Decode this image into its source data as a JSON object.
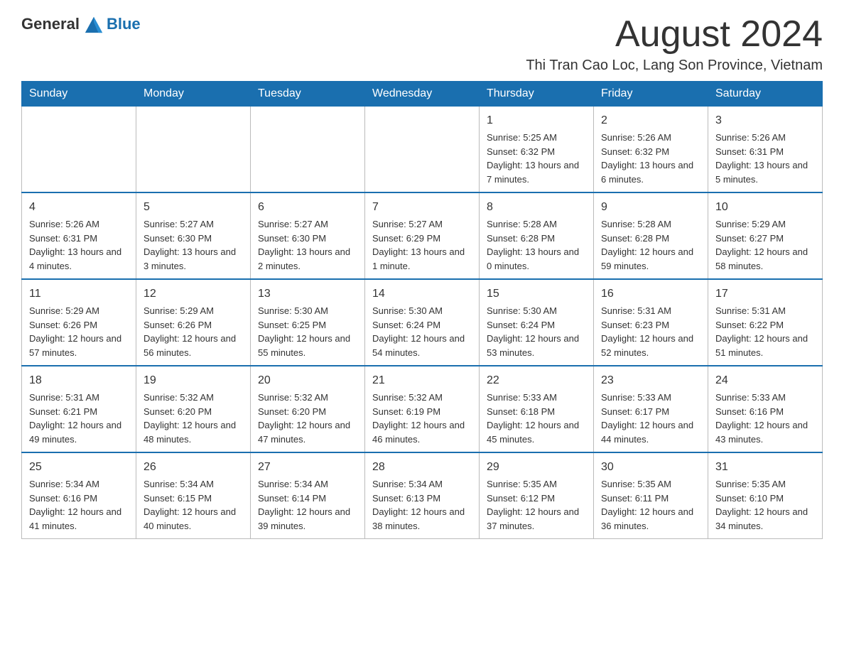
{
  "header": {
    "logo": {
      "text_general": "General",
      "text_blue": "Blue",
      "icon_alt": "GeneralBlue logo"
    },
    "title": "August 2024",
    "subtitle": "Thi Tran Cao Loc, Lang Son Province, Vietnam"
  },
  "calendar": {
    "days_of_week": [
      "Sunday",
      "Monday",
      "Tuesday",
      "Wednesday",
      "Thursday",
      "Friday",
      "Saturday"
    ],
    "weeks": [
      {
        "days": [
          {
            "num": "",
            "info": ""
          },
          {
            "num": "",
            "info": ""
          },
          {
            "num": "",
            "info": ""
          },
          {
            "num": "",
            "info": ""
          },
          {
            "num": "1",
            "info": "Sunrise: 5:25 AM\nSunset: 6:32 PM\nDaylight: 13 hours and 7 minutes."
          },
          {
            "num": "2",
            "info": "Sunrise: 5:26 AM\nSunset: 6:32 PM\nDaylight: 13 hours and 6 minutes."
          },
          {
            "num": "3",
            "info": "Sunrise: 5:26 AM\nSunset: 6:31 PM\nDaylight: 13 hours and 5 minutes."
          }
        ]
      },
      {
        "days": [
          {
            "num": "4",
            "info": "Sunrise: 5:26 AM\nSunset: 6:31 PM\nDaylight: 13 hours and 4 minutes."
          },
          {
            "num": "5",
            "info": "Sunrise: 5:27 AM\nSunset: 6:30 PM\nDaylight: 13 hours and 3 minutes."
          },
          {
            "num": "6",
            "info": "Sunrise: 5:27 AM\nSunset: 6:30 PM\nDaylight: 13 hours and 2 minutes."
          },
          {
            "num": "7",
            "info": "Sunrise: 5:27 AM\nSunset: 6:29 PM\nDaylight: 13 hours and 1 minute."
          },
          {
            "num": "8",
            "info": "Sunrise: 5:28 AM\nSunset: 6:28 PM\nDaylight: 13 hours and 0 minutes."
          },
          {
            "num": "9",
            "info": "Sunrise: 5:28 AM\nSunset: 6:28 PM\nDaylight: 12 hours and 59 minutes."
          },
          {
            "num": "10",
            "info": "Sunrise: 5:29 AM\nSunset: 6:27 PM\nDaylight: 12 hours and 58 minutes."
          }
        ]
      },
      {
        "days": [
          {
            "num": "11",
            "info": "Sunrise: 5:29 AM\nSunset: 6:26 PM\nDaylight: 12 hours and 57 minutes."
          },
          {
            "num": "12",
            "info": "Sunrise: 5:29 AM\nSunset: 6:26 PM\nDaylight: 12 hours and 56 minutes."
          },
          {
            "num": "13",
            "info": "Sunrise: 5:30 AM\nSunset: 6:25 PM\nDaylight: 12 hours and 55 minutes."
          },
          {
            "num": "14",
            "info": "Sunrise: 5:30 AM\nSunset: 6:24 PM\nDaylight: 12 hours and 54 minutes."
          },
          {
            "num": "15",
            "info": "Sunrise: 5:30 AM\nSunset: 6:24 PM\nDaylight: 12 hours and 53 minutes."
          },
          {
            "num": "16",
            "info": "Sunrise: 5:31 AM\nSunset: 6:23 PM\nDaylight: 12 hours and 52 minutes."
          },
          {
            "num": "17",
            "info": "Sunrise: 5:31 AM\nSunset: 6:22 PM\nDaylight: 12 hours and 51 minutes."
          }
        ]
      },
      {
        "days": [
          {
            "num": "18",
            "info": "Sunrise: 5:31 AM\nSunset: 6:21 PM\nDaylight: 12 hours and 49 minutes."
          },
          {
            "num": "19",
            "info": "Sunrise: 5:32 AM\nSunset: 6:20 PM\nDaylight: 12 hours and 48 minutes."
          },
          {
            "num": "20",
            "info": "Sunrise: 5:32 AM\nSunset: 6:20 PM\nDaylight: 12 hours and 47 minutes."
          },
          {
            "num": "21",
            "info": "Sunrise: 5:32 AM\nSunset: 6:19 PM\nDaylight: 12 hours and 46 minutes."
          },
          {
            "num": "22",
            "info": "Sunrise: 5:33 AM\nSunset: 6:18 PM\nDaylight: 12 hours and 45 minutes."
          },
          {
            "num": "23",
            "info": "Sunrise: 5:33 AM\nSunset: 6:17 PM\nDaylight: 12 hours and 44 minutes."
          },
          {
            "num": "24",
            "info": "Sunrise: 5:33 AM\nSunset: 6:16 PM\nDaylight: 12 hours and 43 minutes."
          }
        ]
      },
      {
        "days": [
          {
            "num": "25",
            "info": "Sunrise: 5:34 AM\nSunset: 6:16 PM\nDaylight: 12 hours and 41 minutes."
          },
          {
            "num": "26",
            "info": "Sunrise: 5:34 AM\nSunset: 6:15 PM\nDaylight: 12 hours and 40 minutes."
          },
          {
            "num": "27",
            "info": "Sunrise: 5:34 AM\nSunset: 6:14 PM\nDaylight: 12 hours and 39 minutes."
          },
          {
            "num": "28",
            "info": "Sunrise: 5:34 AM\nSunset: 6:13 PM\nDaylight: 12 hours and 38 minutes."
          },
          {
            "num": "29",
            "info": "Sunrise: 5:35 AM\nSunset: 6:12 PM\nDaylight: 12 hours and 37 minutes."
          },
          {
            "num": "30",
            "info": "Sunrise: 5:35 AM\nSunset: 6:11 PM\nDaylight: 12 hours and 36 minutes."
          },
          {
            "num": "31",
            "info": "Sunrise: 5:35 AM\nSunset: 6:10 PM\nDaylight: 12 hours and 34 minutes."
          }
        ]
      }
    ]
  }
}
